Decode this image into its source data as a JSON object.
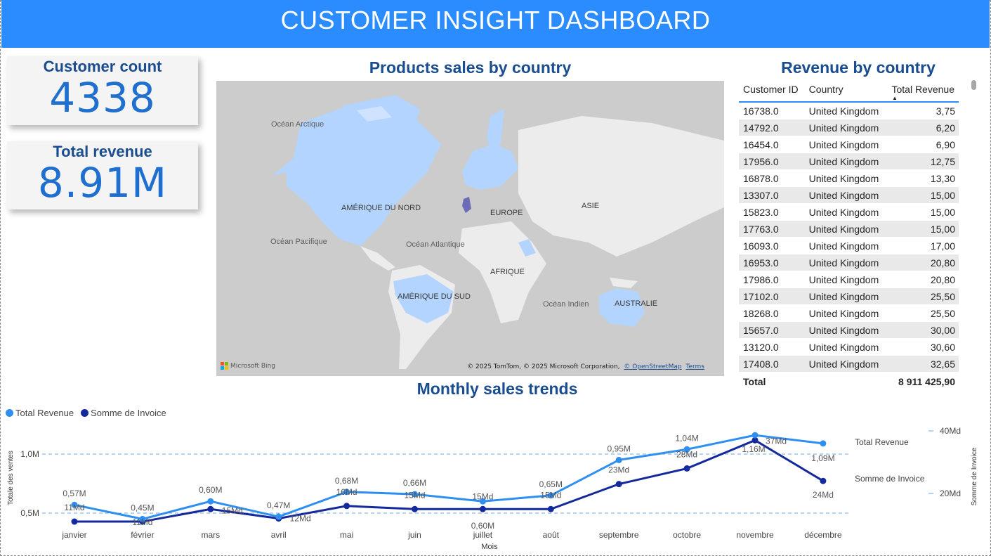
{
  "header": {
    "title": "CUSTOMER INSIGHT DASHBOARD"
  },
  "cards": {
    "customer_count": {
      "title": "Customer count",
      "value": "4338"
    },
    "total_revenue": {
      "title": "Total revenue",
      "value": "8.91M"
    }
  },
  "map": {
    "title": "Products sales by country",
    "labels": {
      "ocean_arctic": "Océan Arctique",
      "ocean_pacific": "Océan Pacifique",
      "ocean_atlantic": "Océan Atlantique",
      "ocean_indian": "Océan Indien",
      "north_america": "AMÉRIQUE DU NORD",
      "south_america": "AMÉRIQUE DU SUD",
      "europe": "EUROPE",
      "asia": "ASIE",
      "africa": "AFRIQUE",
      "australia": "AUSTRALIE"
    },
    "attribution": "© 2025 TomTom, © 2025 Microsoft Corporation,",
    "osm_link": "© OpenStreetMap",
    "terms_link": "Terms",
    "bing_label": "Microsoft Bing",
    "colors": {
      "land": "#ececec",
      "water": "#cccccc",
      "highlight": "#b3d4ff",
      "uk": "#6b6bb8"
    }
  },
  "revenue_table": {
    "title": "Revenue by country",
    "columns": [
      "Customer ID",
      "Country",
      "Total Revenue"
    ],
    "sorted_column": "Total Revenue",
    "rows": [
      [
        "16738.0",
        "United Kingdom",
        "3,75"
      ],
      [
        "14792.0",
        "United Kingdom",
        "6,20"
      ],
      [
        "16454.0",
        "United Kingdom",
        "6,90"
      ],
      [
        "17956.0",
        "United Kingdom",
        "12,75"
      ],
      [
        "16878.0",
        "United Kingdom",
        "13,30"
      ],
      [
        "13307.0",
        "United Kingdom",
        "15,00"
      ],
      [
        "15823.0",
        "United Kingdom",
        "15,00"
      ],
      [
        "17763.0",
        "United Kingdom",
        "15,00"
      ],
      [
        "16093.0",
        "United Kingdom",
        "17,00"
      ],
      [
        "16953.0",
        "United Kingdom",
        "20,80"
      ],
      [
        "17986.0",
        "United Kingdom",
        "20,80"
      ],
      [
        "17102.0",
        "United Kingdom",
        "25,50"
      ],
      [
        "18268.0",
        "United Kingdom",
        "25,50"
      ],
      [
        "15657.0",
        "United Kingdom",
        "30,00"
      ],
      [
        "13120.0",
        "United Kingdom",
        "30,60"
      ],
      [
        "17408.0",
        "United Kingdom",
        "32,65"
      ]
    ],
    "total_label": "Total",
    "total_value": "8 911 425,90"
  },
  "trends": {
    "title": "Monthly sales trends",
    "legend": [
      "Total Revenue",
      "Somme de Invoice"
    ]
  },
  "chart_data": {
    "type": "line",
    "title": "Monthly sales trends",
    "xlabel": "Mois",
    "ylabel": "Totale des ventes",
    "y2label": "Somme de Invoice",
    "categories": [
      "janvier",
      "février",
      "mars",
      "avril",
      "mai",
      "juin",
      "juillet",
      "août",
      "septembre",
      "octobre",
      "novembre",
      "décembre"
    ],
    "y_ticks": [
      "0,5M",
      "1,0M"
    ],
    "y2_ticks": [
      "20Md",
      "40Md"
    ],
    "ylim": [
      0.3,
      1.2
    ],
    "y2lim": [
      5,
      45
    ],
    "grid": "dashed",
    "legend_position": "top-left",
    "series": [
      {
        "name": "Total Revenue",
        "axis": "left",
        "color": "#2f8ff0",
        "values": [
          0.57,
          0.45,
          0.6,
          0.47,
          0.68,
          0.66,
          0.6,
          0.65,
          0.95,
          1.04,
          1.16,
          1.09
        ],
        "labels": [
          "0,57M",
          "0,45M",
          "0,60M",
          "0,47M",
          "0,68M",
          "0,66M",
          "0,60M",
          "0,65M",
          "0,95M",
          "1,04M",
          "1,16M",
          "1,09M"
        ]
      },
      {
        "name": "Somme de Invoice",
        "axis": "right",
        "color": "#13299c",
        "values": [
          11,
          11,
          15,
          12,
          16,
          15,
          15,
          15,
          23,
          28,
          37,
          24
        ],
        "labels": [
          "11Md",
          "11Md",
          "15Md",
          "12Md",
          "16Md",
          "15Md",
          "15Md",
          "15Md",
          "23Md",
          "28Md",
          "37Md",
          "24Md"
        ]
      }
    ],
    "end_labels": [
      "Total Revenue",
      "Somme de Invoice"
    ]
  }
}
